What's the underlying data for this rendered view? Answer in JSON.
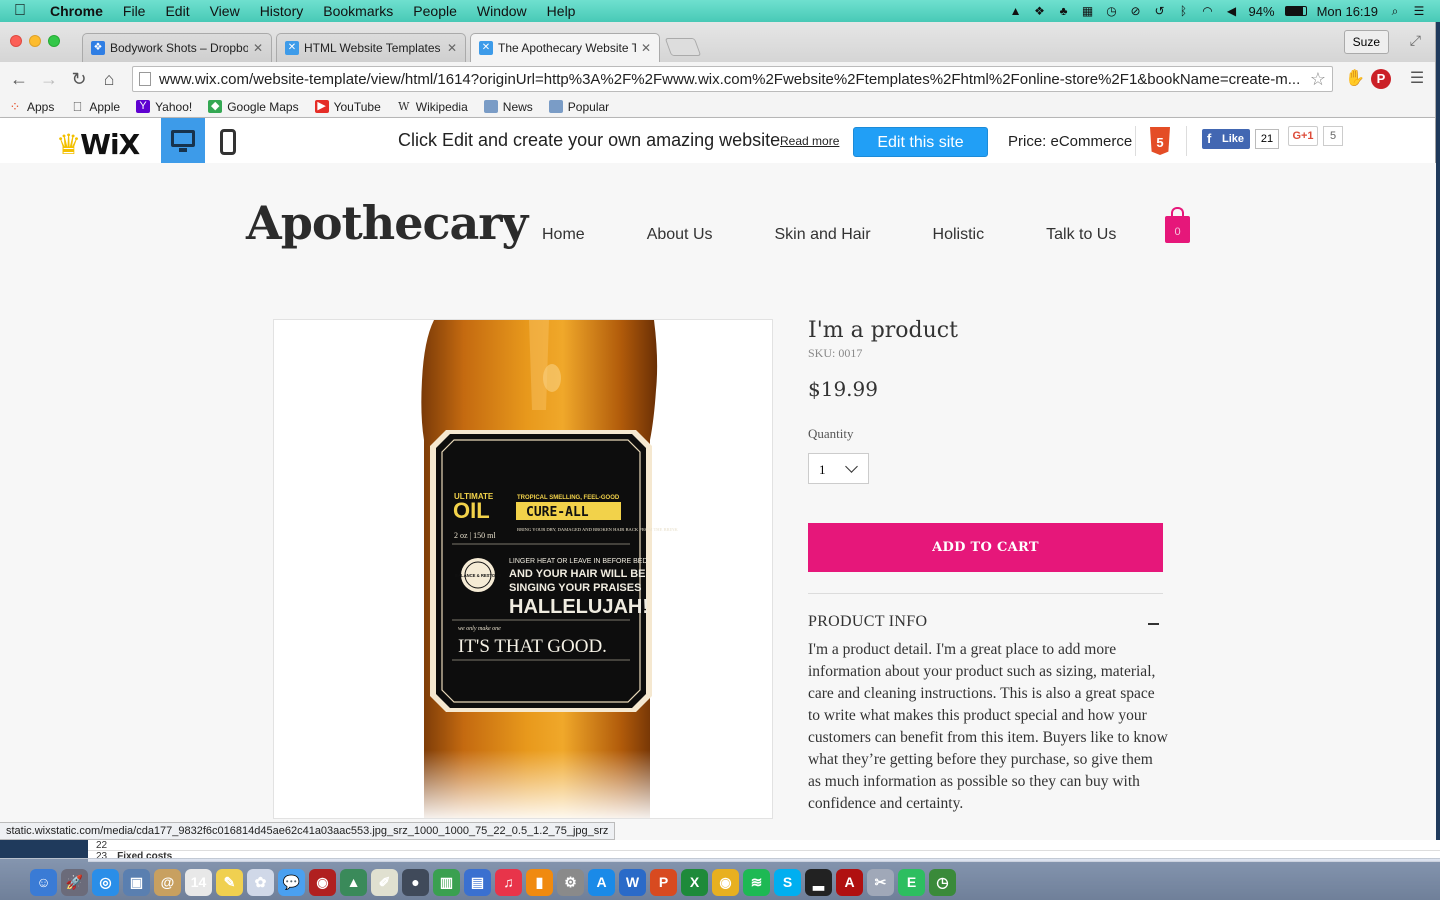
{
  "menubar": {
    "app": "Chrome",
    "items": [
      "File",
      "Edit",
      "View",
      "History",
      "Bookmarks",
      "People",
      "Window",
      "Help"
    ],
    "battery": "94%",
    "clock": "Mon 16:19"
  },
  "tabs": [
    {
      "title": "Bodywork Shots – Dropbox",
      "favicon_color": "#2f7ee4"
    },
    {
      "title": "HTML Website Templates | Wix",
      "favicon_color": "#3d9be9"
    },
    {
      "title": "The Apothecary Website Template",
      "favicon_color": "#3d9be9"
    }
  ],
  "profile_button": "Suze",
  "address_bar": {
    "url": "www.wix.com/website-template/view/html/1614?originUrl=http%3A%2F%2Fwww.wix.com%2Fwebsite%2Ftemplates%2Fhtml%2Fonline-store%2F1&bookName=create-m..."
  },
  "bookmarks": [
    {
      "label": "Apps",
      "icon": "apps-grid-icon",
      "color": "#e34c26"
    },
    {
      "label": "Apple",
      "icon": "apple-icon",
      "color": "#555555"
    },
    {
      "label": "Yahoo!",
      "icon": "yahoo-icon",
      "color": "#5f01d1"
    },
    {
      "label": "Google Maps",
      "icon": "maps-icon",
      "color": "#34a853"
    },
    {
      "label": "YouTube",
      "icon": "youtube-icon",
      "color": "#e52d27"
    },
    {
      "label": "Wikipedia",
      "icon": "wikipedia-icon",
      "color": "#333333"
    },
    {
      "label": "News",
      "icon": "folder-icon",
      "color": "#7a9cc6"
    },
    {
      "label": "Popular",
      "icon": "folder-icon",
      "color": "#7a9cc6"
    }
  ],
  "wixbar": {
    "logo": "WiX",
    "promo_text": "Click Edit and create your own amazing website",
    "read_more": "Read more",
    "edit_button": "Edit this site",
    "price_label": "Price: eCommerce",
    "html5_badge": "5",
    "fb_like": "Like",
    "fb_count": "21",
    "gplus": "G+1",
    "gplus_count": "5"
  },
  "site": {
    "title": "Apothecary",
    "nav": [
      "Home",
      "About Us",
      "Skin and Hair",
      "Holistic",
      "Talk to Us"
    ],
    "cart_count": "0",
    "accent": "#e6177a"
  },
  "product": {
    "name": "I'm a product",
    "sku": "SKU: 0017",
    "price": "$19.99",
    "quantity_label": "Quantity",
    "quantity_value": "1",
    "add_to_cart": "ADD TO CART",
    "info_title": "PRODUCT INFO",
    "info_text": "I'm a product detail. I'm a great place to add more information about your product such as sizing, material, care and cleaning instructions. This is also a great space to write what makes this product special and how your customers can benefit from this item. Buyers like to know what they’re getting before they purchase, so give them as much information as possible so they can buy with confidence and certainty.",
    "label": {
      "line1": "ULTIMATE",
      "oil": "OIL",
      "tag1": "TROPICAL SMELLING, FEEL-GOOD",
      "cureall": "CURE-ALL",
      "size": "2 oz | 150 ml",
      "tag2": "BRING YOUR DRY, DAMAGED AND BROKEN HAIR BACK FROM THE BRINK",
      "seal": "BALANCE & RESTORE",
      "body1": "LINGER HEAT OR LEAVE IN BEFORE BED",
      "body2": "AND YOUR HAIR WILL BE",
      "body3": "SINGING YOUR PRAISES",
      "hallelujah": "HALLELUJAH!",
      "small": "we only make one",
      "good": "IT'S THAT GOOD."
    }
  },
  "status_url": "static.wixstatic.com/media/cda177_9832f6c016814d45ae62c41a03aac553.jpg_srz_1000_1000_75_22_0.5_1.2_75_jpg_srz",
  "behind_window": {
    "row1": "22",
    "row2_num": "23",
    "row2_text": "Fixed costs"
  },
  "dock": [
    {
      "name": "finder-icon",
      "glyph": "☺",
      "color": "#3a7bd5"
    },
    {
      "name": "launchpad-icon",
      "glyph": "🚀",
      "color": "#6b6b7a"
    },
    {
      "name": "safari-icon",
      "glyph": "◎",
      "color": "#2a8ee8"
    },
    {
      "name": "preview-icon",
      "glyph": "▣",
      "color": "#5a7fb0"
    },
    {
      "name": "contacts-icon",
      "glyph": "@",
      "color": "#c8a060"
    },
    {
      "name": "calendar-icon",
      "glyph": "14",
      "color": "#e8e8e8"
    },
    {
      "name": "notes-icon",
      "glyph": "✎",
      "color": "#f0d050"
    },
    {
      "name": "photos-icon",
      "glyph": "✿",
      "color": "#d0d8e8"
    },
    {
      "name": "messages-icon",
      "glyph": "💬",
      "color": "#4aa0f0"
    },
    {
      "name": "photobooth-icon",
      "glyph": "◉",
      "color": "#b02020"
    },
    {
      "name": "iphoto-icon",
      "glyph": "▲",
      "color": "#3a8a5a"
    },
    {
      "name": "textedit-icon",
      "glyph": "✐",
      "color": "#e0e0d0"
    },
    {
      "name": "camera-icon",
      "glyph": "●",
      "color": "#404a5a"
    },
    {
      "name": "numbers-icon",
      "glyph": "▥",
      "color": "#3aa050"
    },
    {
      "name": "keynote-icon",
      "glyph": "▤",
      "color": "#3a70d0"
    },
    {
      "name": "itunes-icon",
      "glyph": "♫",
      "color": "#e8344a"
    },
    {
      "name": "ibooks-icon",
      "glyph": "▮",
      "color": "#f08a10"
    },
    {
      "name": "preferences-icon",
      "glyph": "⚙",
      "color": "#8a8a8a"
    },
    {
      "name": "appstore-icon",
      "glyph": "A",
      "color": "#1a8ae8"
    },
    {
      "name": "word-icon",
      "glyph": "W",
      "color": "#2a6ac8"
    },
    {
      "name": "powerpoint-icon",
      "glyph": "P",
      "color": "#d84a20"
    },
    {
      "name": "excel-icon",
      "glyph": "X",
      "color": "#1e8a3a"
    },
    {
      "name": "chrome-icon",
      "glyph": "◉",
      "color": "#e8b020"
    },
    {
      "name": "spotify-icon",
      "glyph": "≋",
      "color": "#1db954"
    },
    {
      "name": "skype-icon",
      "glyph": "S",
      "color": "#00aff0"
    },
    {
      "name": "activity-monitor-icon",
      "glyph": "▂",
      "color": "#222222"
    },
    {
      "name": "acrobat-icon",
      "glyph": "A",
      "color": "#b01010"
    },
    {
      "name": "utility-icon",
      "glyph": "✂",
      "color": "#a0a8b8"
    },
    {
      "name": "evernote-icon",
      "glyph": "E",
      "color": "#2dbe60"
    },
    {
      "name": "timemachine-icon",
      "glyph": "◷",
      "color": "#3a8a3a"
    }
  ]
}
